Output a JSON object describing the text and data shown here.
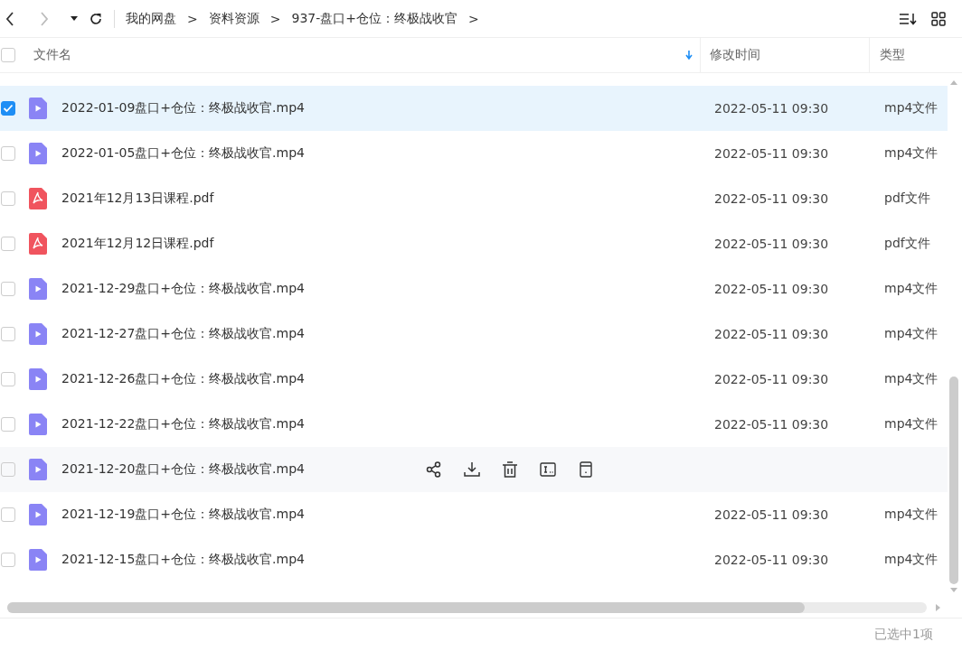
{
  "breadcrumb": [
    "我的网盘",
    "资料资源",
    "937-盘口+仓位：终极战收官"
  ],
  "breadcrumb_separator": ">",
  "table": {
    "columns": [
      {
        "label": "文件名",
        "sorted": true
      },
      {
        "label": "修改时间",
        "sorted": false
      },
      {
        "label": "类型",
        "sorted": false
      }
    ],
    "select_all": {
      "checked": false
    },
    "rows": [
      {
        "kind": "video",
        "name": "2022-01-09盘口+仓位：终极战收官.mp4",
        "modified": "2022-05-11 09:30",
        "type": "mp4文件",
        "selected": true,
        "hovered": false
      },
      {
        "kind": "video",
        "name": "2022-01-05盘口+仓位：终极战收官.mp4",
        "modified": "2022-05-11 09:30",
        "type": "mp4文件",
        "selected": false,
        "hovered": false
      },
      {
        "kind": "pdf",
        "name": "2021年12月13日课程.pdf",
        "modified": "2022-05-11 09:30",
        "type": "pdf文件",
        "selected": false,
        "hovered": false
      },
      {
        "kind": "pdf",
        "name": "2021年12月12日课程.pdf",
        "modified": "2022-05-11 09:30",
        "type": "pdf文件",
        "selected": false,
        "hovered": false
      },
      {
        "kind": "video",
        "name": "2021-12-29盘口+仓位：终极战收官.mp4",
        "modified": "2022-05-11 09:30",
        "type": "mp4文件",
        "selected": false,
        "hovered": false
      },
      {
        "kind": "video",
        "name": "2021-12-27盘口+仓位：终极战收官.mp4",
        "modified": "2022-05-11 09:30",
        "type": "mp4文件",
        "selected": false,
        "hovered": false
      },
      {
        "kind": "video",
        "name": "2021-12-26盘口+仓位：终极战收官.mp4",
        "modified": "2022-05-11 09:30",
        "type": "mp4文件",
        "selected": false,
        "hovered": false
      },
      {
        "kind": "video",
        "name": "2021-12-22盘口+仓位：终极战收官.mp4",
        "modified": "2022-05-11 09:30",
        "type": "mp4文件",
        "selected": false,
        "hovered": false
      },
      {
        "kind": "video",
        "name": "2021-12-20盘口+仓位：终极战收官.mp4",
        "selected": false,
        "hovered": true
      },
      {
        "kind": "video",
        "name": "2021-12-19盘口+仓位：终极战收官.mp4",
        "modified": "2022-05-11 09:30",
        "type": "mp4文件",
        "selected": false,
        "hovered": false
      },
      {
        "kind": "video",
        "name": "2021-12-15盘口+仓位：终极战收官.mp4",
        "modified": "2022-05-11 09:30",
        "type": "mp4文件",
        "selected": false,
        "hovered": false
      }
    ]
  },
  "status_bar": {
    "text": "已选中1项"
  }
}
